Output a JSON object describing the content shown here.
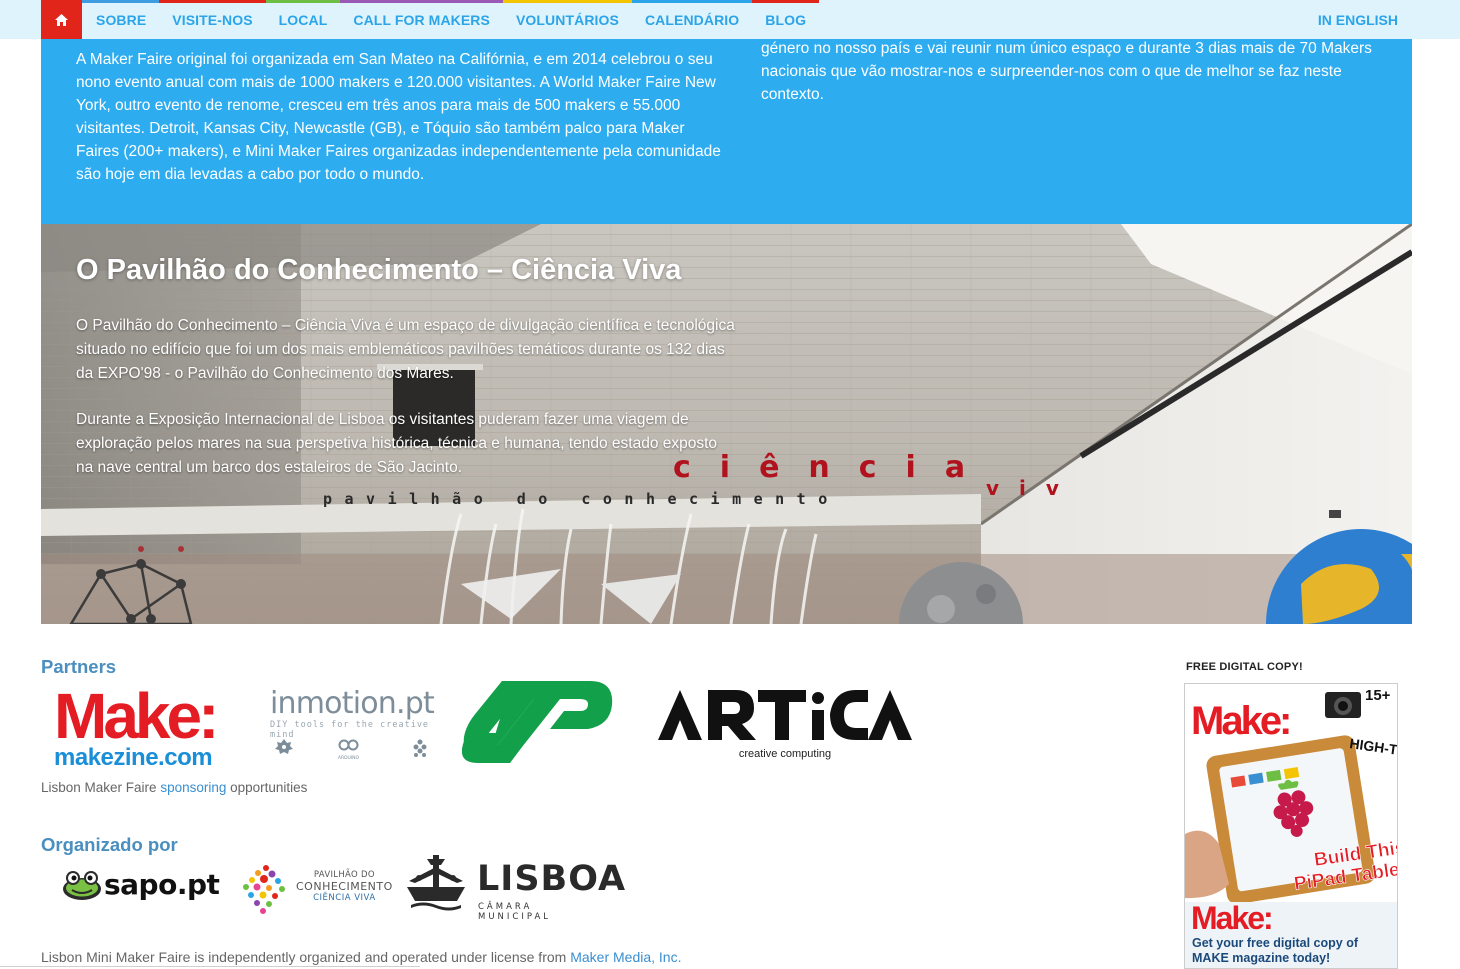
{
  "nav": {
    "home_icon": "home-icon",
    "items": [
      {
        "label": "SOBRE",
        "color": "#3e9de0"
      },
      {
        "label": "VISITE-NOS",
        "color": "#e1251b"
      },
      {
        "label": "LOCAL",
        "color": "#6fbe44"
      },
      {
        "label": "CALL FOR MAKERS",
        "color": "#9b59b6"
      },
      {
        "label": "VOLUNTÁRIOS",
        "color": "#f5c400"
      },
      {
        "label": "CALENDÁRIO",
        "color": "#2ba5e8"
      },
      {
        "label": "BLOG",
        "color": "#e1251b"
      }
    ],
    "english": "IN ENGLISH"
  },
  "intro": {
    "left_text": "A Maker Faire original foi organizada em San Mateo na Califórnia, e em 2014 celebrou o seu nono evento anual com mais de 1000 makers e 120.000 visitantes. A World Maker Faire New York, outro evento de renome, cresceu em três anos para mais de 500 makers e 55.000 visitantes. Detroit, Kansas City, Newcastle (GB), e Tóquio são também palco para Maker Faires (200+ makers), e Mini Maker Faires organizadas independentemente pela comunidade são hoje em dia levadas a cabo por todo o mundo.",
    "right_text": "género no nosso país e vai reunir num único espaço e durante 3 dias mais de 70 Makers nacionais que vão mostrar-nos e surpreender-nos com o que de melhor se faz neste contexto."
  },
  "hero": {
    "title": "O Pavilhão do Conhecimento – Ciência Viva",
    "paragraph1": "O Pavilhão do Conhecimento – Ciência Viva é um espaço de divulgação científica e tecnológica situado no edifício que foi um dos mais emblemáticos pavilhões temáticos durante os 132 dias da EXPO'98 - o Pavilhão do Conhecimento dos Mares.",
    "paragraph2": "Durante a Exposição Internacional de Lisboa os visitantes puderam fazer uma viagem de exploração pelos mares na sua perspetiva histórica, técnica e humana, tendo estado exposto na nave central um barco dos estaleiros de São Jacinto.",
    "wall_sign_ciencia": "ciência",
    "wall_sign_viva": "viv",
    "wall_sign_pavilhao": "pavilhão do conhecimento"
  },
  "partners": {
    "heading": "Partners",
    "make_word": "Make:",
    "make_url": "makezine.com",
    "inmotion_word": "inmotion.pt",
    "inmotion_tag": "DIY tools for the creative mind",
    "inmotion_arduino": "ARDUINO",
    "artica_tag": "creative computing",
    "sponsor_prefix": "Lisbon Maker Faire ",
    "sponsor_link": "sponsoring",
    "sponsor_suffix": " opportunities"
  },
  "organizers": {
    "heading": "Organizado por",
    "sapo": "sapo.pt",
    "pcv_line1": "PAVILHÃO DO",
    "pcv_line2": "CONHECIMENTO",
    "pcv_line3": "CIÊNCIA VIVA",
    "lisboa": "LISBOA",
    "lisboa_sub": "CÂMARA MUNICIPAL"
  },
  "license": {
    "prefix": "Lisbon Mini Maker Faire is independently organized and operated under license from ",
    "link": "Maker Media, Inc."
  },
  "sidebar": {
    "free_copy": "FREE DIGITAL COPY!",
    "cover_title": "Make:",
    "cover_badge": "15+",
    "cover_headline": "HIGH-TECH DIY",
    "cover_build1": "Build This",
    "cover_build2": "PiPad Table",
    "cta_title": "Make:",
    "cta_text": "Get your free digital copy of MAKE magazine today!"
  },
  "colors": {
    "intro_bg": "#2dacf0",
    "nav_bg": "#dff3fc",
    "home_bg": "#e1251b",
    "link": "#3a8fd0",
    "make_red": "#e41c24",
    "cp_green": "#12a04a"
  }
}
